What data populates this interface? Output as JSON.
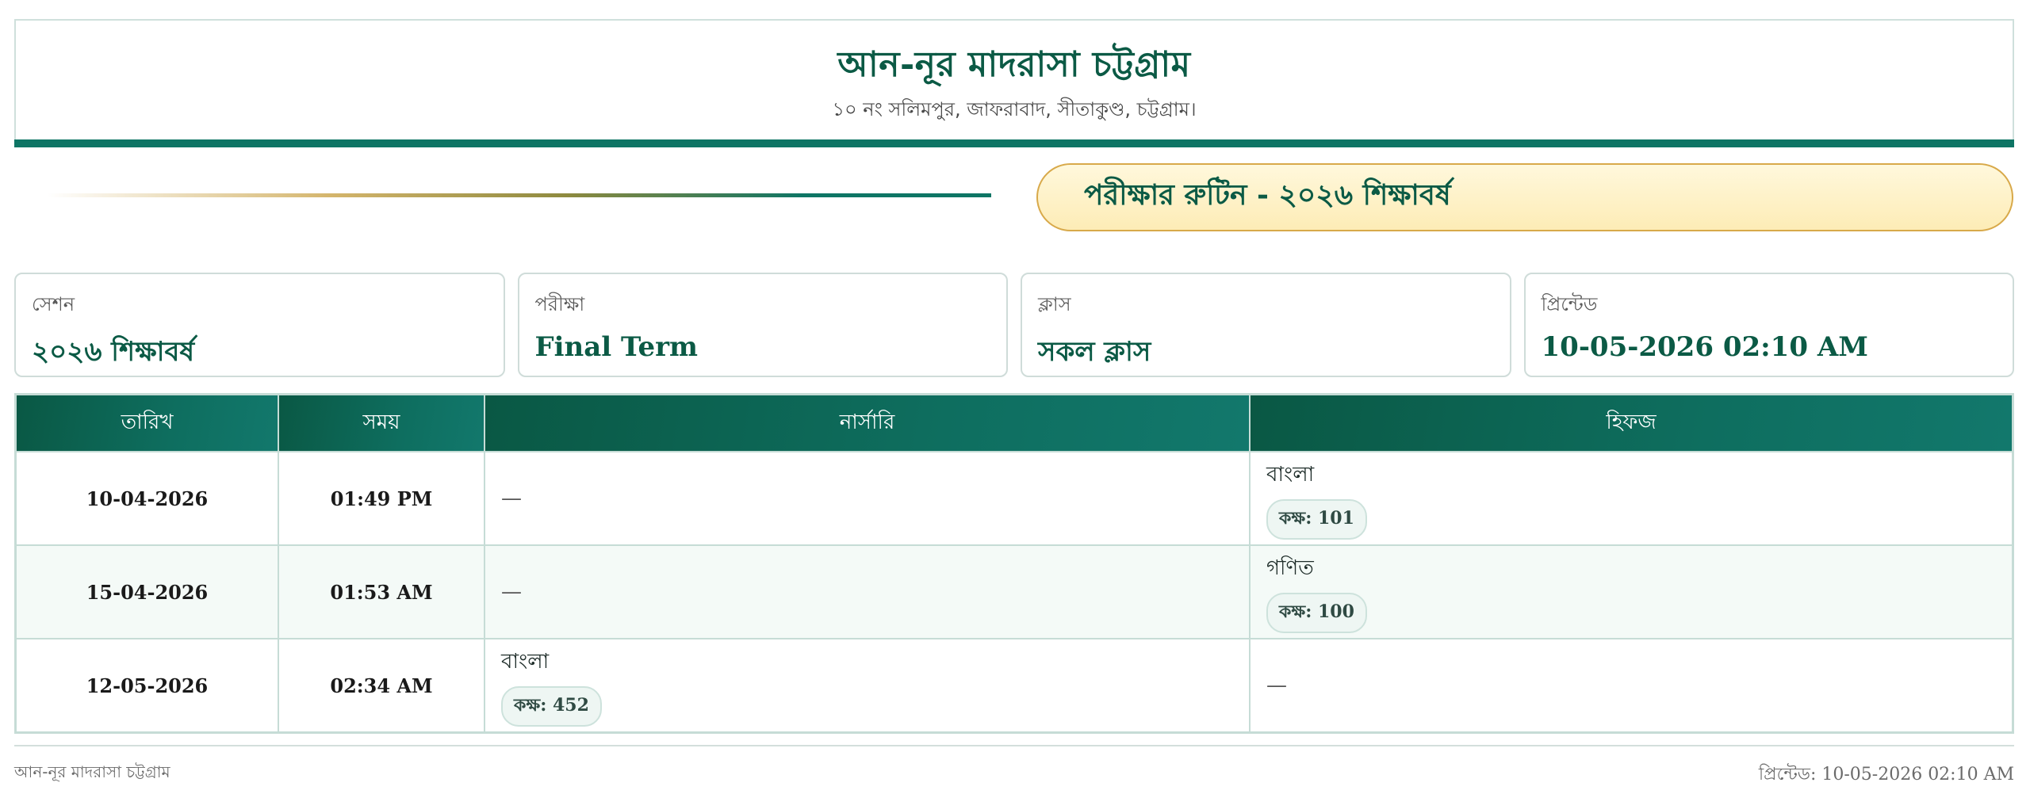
{
  "header": {
    "title": "আন-নূর মাদরাসা চট্টগ্রাম",
    "address": "১০ নং সলিমপুর, জাফরাবাদ, সীতাকুণ্ড, চট্টগ্রাম।"
  },
  "routine_title": "পরীক্ষার রুটিন - ২০২৬ শিক্ষাবর্ষ",
  "cards": [
    {
      "label": "সেশন",
      "value": "২০২৬ শিক্ষাবর্ষ"
    },
    {
      "label": "পরীক্ষা",
      "value": "Final Term"
    },
    {
      "label": "ক্লাস",
      "value": "সকল ক্লাস"
    },
    {
      "label": "প্রিন্টেড",
      "value": "10-05-2026 02:10 AM"
    }
  ],
  "table": {
    "headers": [
      "তারিখ",
      "সময়",
      "নার্সারি",
      "হিফজ"
    ],
    "rows": [
      {
        "date": "10-04-2026",
        "time": "01:49 PM",
        "nursery": {
          "empty": "—"
        },
        "hifz": {
          "subject": "বাংলা",
          "room": "কক্ষ: 101"
        }
      },
      {
        "date": "15-04-2026",
        "time": "01:53 AM",
        "nursery": {
          "empty": "—"
        },
        "hifz": {
          "subject": "গণিত",
          "room": "কক্ষ: 100"
        }
      },
      {
        "date": "12-05-2026",
        "time": "02:34 AM",
        "nursery": {
          "subject": "বাংলা",
          "room": "কক্ষ: 452"
        },
        "hifz": {
          "empty": "—"
        }
      }
    ]
  },
  "footer": {
    "left": "আন-নূর মাদরাসা চট্টগ্রাম",
    "right": "প্রিন্টেড: 10-05-2026 02:10 AM"
  }
}
